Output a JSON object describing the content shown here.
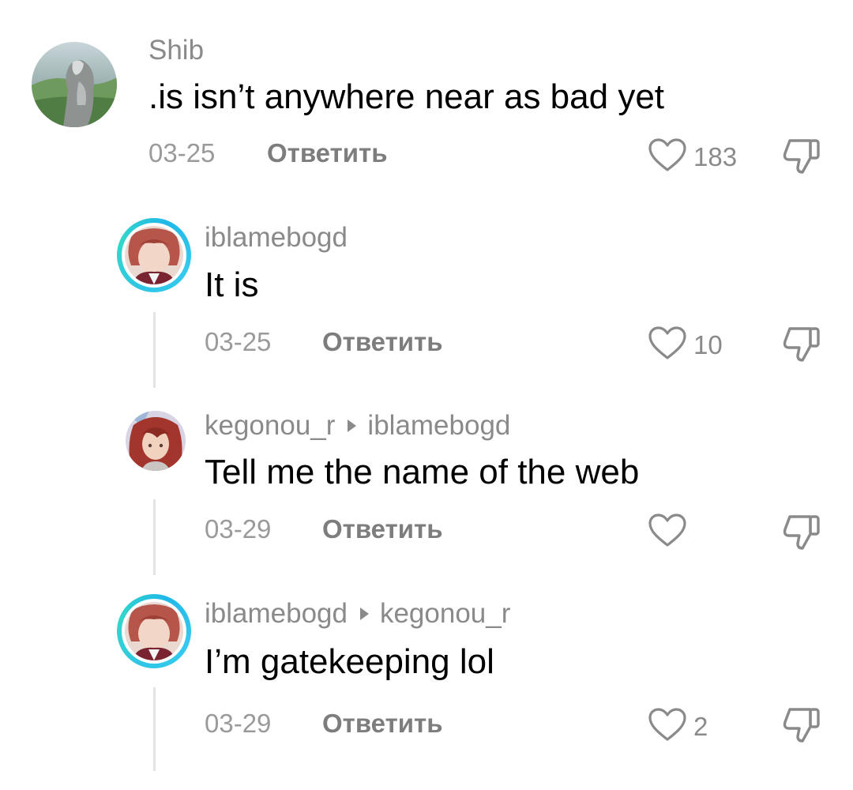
{
  "comments": [
    {
      "username": "Shib",
      "reply_to": "",
      "text": ".is isn’t anywhere near as bad yet",
      "date": "03-25",
      "reply_label": "Ответить",
      "likes": "183"
    },
    {
      "username": "iblamebogd",
      "reply_to": "",
      "text": "It is",
      "date": "03-25",
      "reply_label": "Ответить",
      "likes": "10"
    },
    {
      "username": "kegonou_r",
      "reply_to": "iblamebogd",
      "text": "Tell me the name of the web",
      "date": "03-29",
      "reply_label": "Ответить",
      "likes": ""
    },
    {
      "username": "iblamebogd",
      "reply_to": "kegonou_r",
      "text": "I’m gatekeeping lol",
      "date": "03-29",
      "reply_label": "Ответить",
      "likes": "2"
    }
  ],
  "colors": {
    "story_ring": "#2fc6e6",
    "muted_text": "#8a8a8a",
    "thread_line": "#e4e4e4"
  },
  "icons": {
    "like": "heart-outline-icon",
    "dislike": "thumbs-down-icon",
    "reply_to": "triangle-right-icon"
  }
}
